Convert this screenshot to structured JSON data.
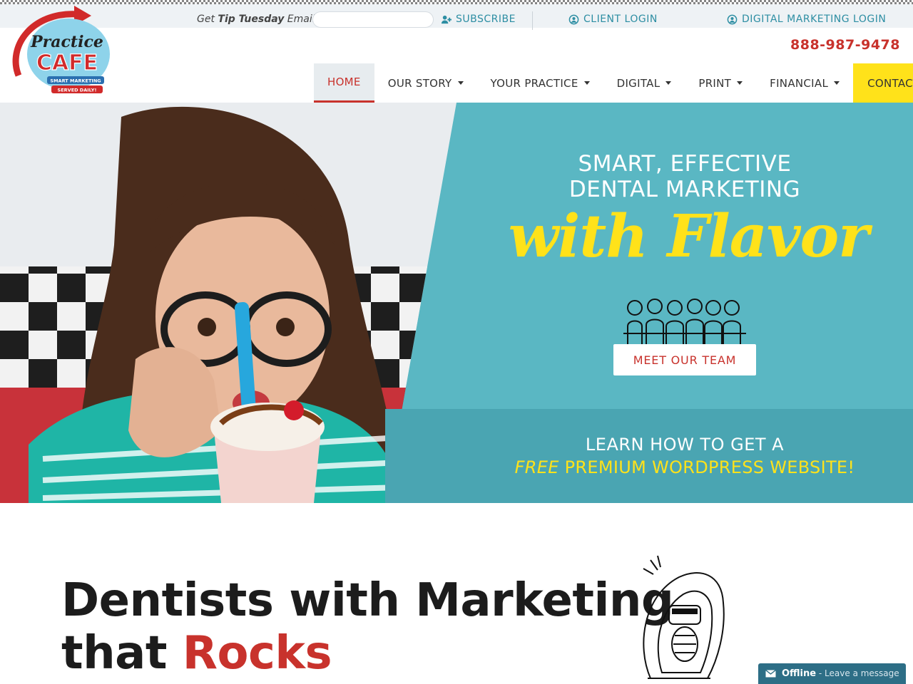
{
  "topbar": {
    "tip_prefix": "Get ",
    "tip_bold": "Tip Tuesday",
    "tip_suffix": " Emails",
    "subscribe": "SUBSCRIBE",
    "client_login": "CLIENT LOGIN",
    "digital_login": "DIGITAL MARKETING LOGIN"
  },
  "logo": {
    "line1": "Practice",
    "line2": "CAFE",
    "tag1": "SMART MARKETING",
    "tag2": "SERVED DAILY!"
  },
  "phone": "888-987-9478",
  "nav": {
    "items": [
      {
        "label": "HOME",
        "active": true,
        "dropdown": false
      },
      {
        "label": "OUR STORY",
        "dropdown": true
      },
      {
        "label": "YOUR PRACTICE",
        "dropdown": true
      },
      {
        "label": "DIGITAL",
        "dropdown": true
      },
      {
        "label": "PRINT",
        "dropdown": true
      },
      {
        "label": "FINANCIAL",
        "dropdown": true
      },
      {
        "label": "CONTACT",
        "dropdown": false
      }
    ]
  },
  "hero": {
    "line1": "SMART, EFFECTIVE",
    "line2": "DENTAL MARKETING",
    "script": "with Flavor",
    "team_button": "MEET OUR TEAM",
    "learn_line1": "LEARN HOW TO GET A",
    "learn_free": "FREE",
    "learn_line2": " PREMIUM WORDPRESS WEBSITE!"
  },
  "section": {
    "headline_line1": "Dentists with Marketing",
    "headline_line2_start": "that ",
    "headline_accent": "Rocks"
  },
  "chat": {
    "status": "Offline",
    "message": " - Leave a message"
  },
  "colors": {
    "brand_red": "#c8322c",
    "teal": "#5ab7c3",
    "yellow": "#ffe21a",
    "link_teal": "#2d8ea3"
  }
}
